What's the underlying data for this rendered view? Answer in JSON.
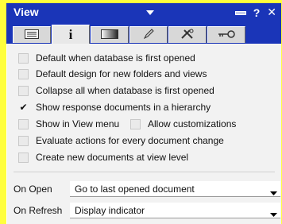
{
  "window": {
    "title": "View"
  },
  "tabs": [
    {
      "icon": "list-icon"
    },
    {
      "icon": "info-icon"
    },
    {
      "icon": "gradient-icon"
    },
    {
      "icon": "pencil-icon"
    },
    {
      "icon": "tools-icon"
    },
    {
      "icon": "key-icon"
    }
  ],
  "options": [
    {
      "label": "Default when database is first opened",
      "checked": false
    },
    {
      "label": "Default design for new folders and views",
      "checked": false
    },
    {
      "label": "Collapse all when database is first opened",
      "checked": false
    },
    {
      "label": "Show response documents in a hierarchy",
      "checked": true
    },
    {
      "label": "Show in View menu",
      "checked": false
    },
    {
      "label": "Evaluate actions for every document change",
      "checked": false
    },
    {
      "label": "Create new documents at view level",
      "checked": false
    }
  ],
  "allow_customizations": {
    "label": "Allow customizations",
    "checked": false
  },
  "on_open": {
    "label": "On Open",
    "value": "Go to last opened document"
  },
  "on_refresh": {
    "label": "On Refresh",
    "value": "Display indicator"
  }
}
